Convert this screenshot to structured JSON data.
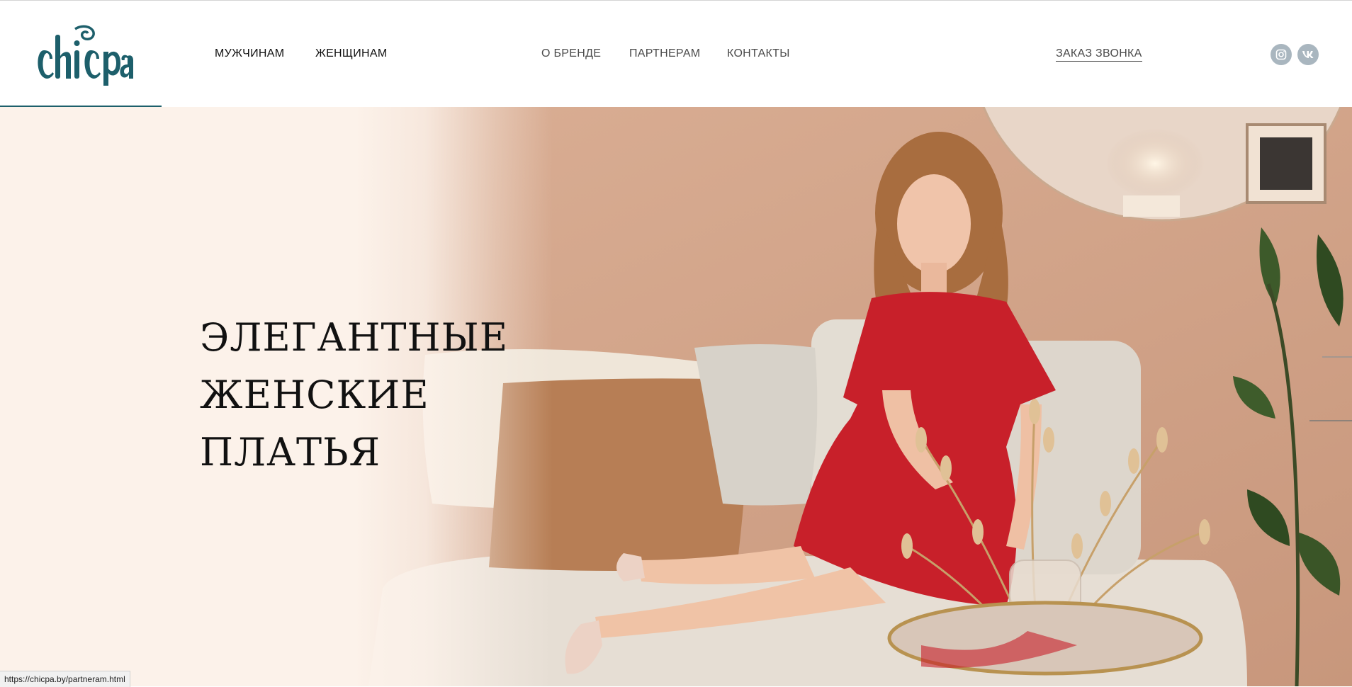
{
  "brand": {
    "logo_text": "chicpa"
  },
  "nav": {
    "left": [
      {
        "label": "МУЖЧИНАМ"
      },
      {
        "label": "ЖЕНЩИНАМ"
      }
    ],
    "center": [
      {
        "label": "О БРЕНДЕ"
      },
      {
        "label": "ПАРТНЕРАМ"
      },
      {
        "label": "КОНТАКТЫ"
      }
    ],
    "callback_label": "ЗАКАЗ ЗВОНКА"
  },
  "social": [
    {
      "icon": "instagram-icon"
    },
    {
      "icon": "vk-icon"
    }
  ],
  "hero": {
    "headline_lines": [
      "ЭЛЕГАНТНЫЕ",
      "ЖЕНСКИЕ",
      "ПЛАТЬЯ"
    ]
  },
  "status_bar": {
    "url": "https://chicpa.by/partneram.html"
  },
  "colors": {
    "brand_teal": "#1d5f6b",
    "hero_bg": "#fcf2ea",
    "dress_red": "#c8202a",
    "social_icon_bg": "#a9b6bf"
  }
}
